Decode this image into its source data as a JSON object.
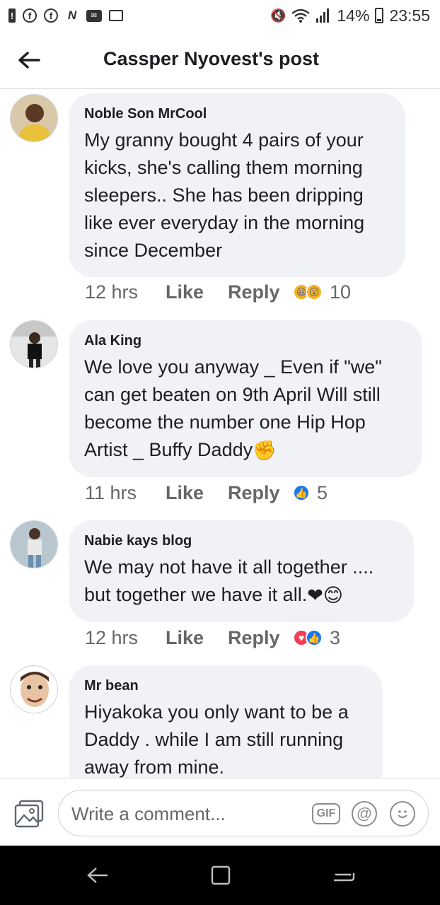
{
  "status_bar": {
    "battery": "14%",
    "time": "23:55",
    "left_icons": [
      "alert-icon",
      "facebook-icon",
      "facebook-icon",
      "n-icon",
      "message-icon",
      "gallery-icon"
    ],
    "right_icons": [
      "mute-icon",
      "wifi-icon",
      "signal-icon",
      "battery-icon"
    ]
  },
  "header": {
    "title": "Cassper Nyovest's post",
    "back_icon": "arrow-left-icon"
  },
  "comments": [
    {
      "author": "Noble Son MrCool",
      "text": "My granny bought 4 pairs of your kicks, she's calling them morning sleepers.. She has been dripping like ever everyday in the morning since December",
      "time": "12 hrs",
      "like_label": "Like",
      "reply_label": "Reply",
      "reactions": [
        "haha",
        "wow"
      ],
      "reaction_count": "10"
    },
    {
      "author": "Ala King",
      "text": "We love you anyway _ Even if \"we\" can get beaten on 9th April Will still become the number one Hip Hop Artist _ Buffy Daddy",
      "text_emoji": "✊",
      "time": "11 hrs",
      "like_label": "Like",
      "reply_label": "Reply",
      "reactions": [
        "like"
      ],
      "reaction_count": "5"
    },
    {
      "author": "Nabie kays blog",
      "text": "We may not have it all together .... but together we have it all.",
      "text_emoji": "❤😊",
      "time": "12 hrs",
      "like_label": "Like",
      "reply_label": "Reply",
      "reactions": [
        "love",
        "like"
      ],
      "reaction_count": "3"
    },
    {
      "author": "Mr bean",
      "text": "Hiyakoka you only want to be a Daddy . while I am still running away from mine."
    }
  ],
  "composer": {
    "placeholder": "Write a comment...",
    "gif_label": "GIF",
    "at_label": "@",
    "photo_icon": "photo-icon",
    "emoji_icon": "smiley-icon"
  },
  "nav_bar": {
    "icons": [
      "back-nav-icon",
      "recents-icon",
      "home-switch-icon"
    ]
  },
  "colors": {
    "bubble": "#f0f2f5",
    "meta_text": "#65676b",
    "like_blue": "#1877f2",
    "love_red": "#f33e58",
    "haha_yellow": "#f7b125"
  }
}
